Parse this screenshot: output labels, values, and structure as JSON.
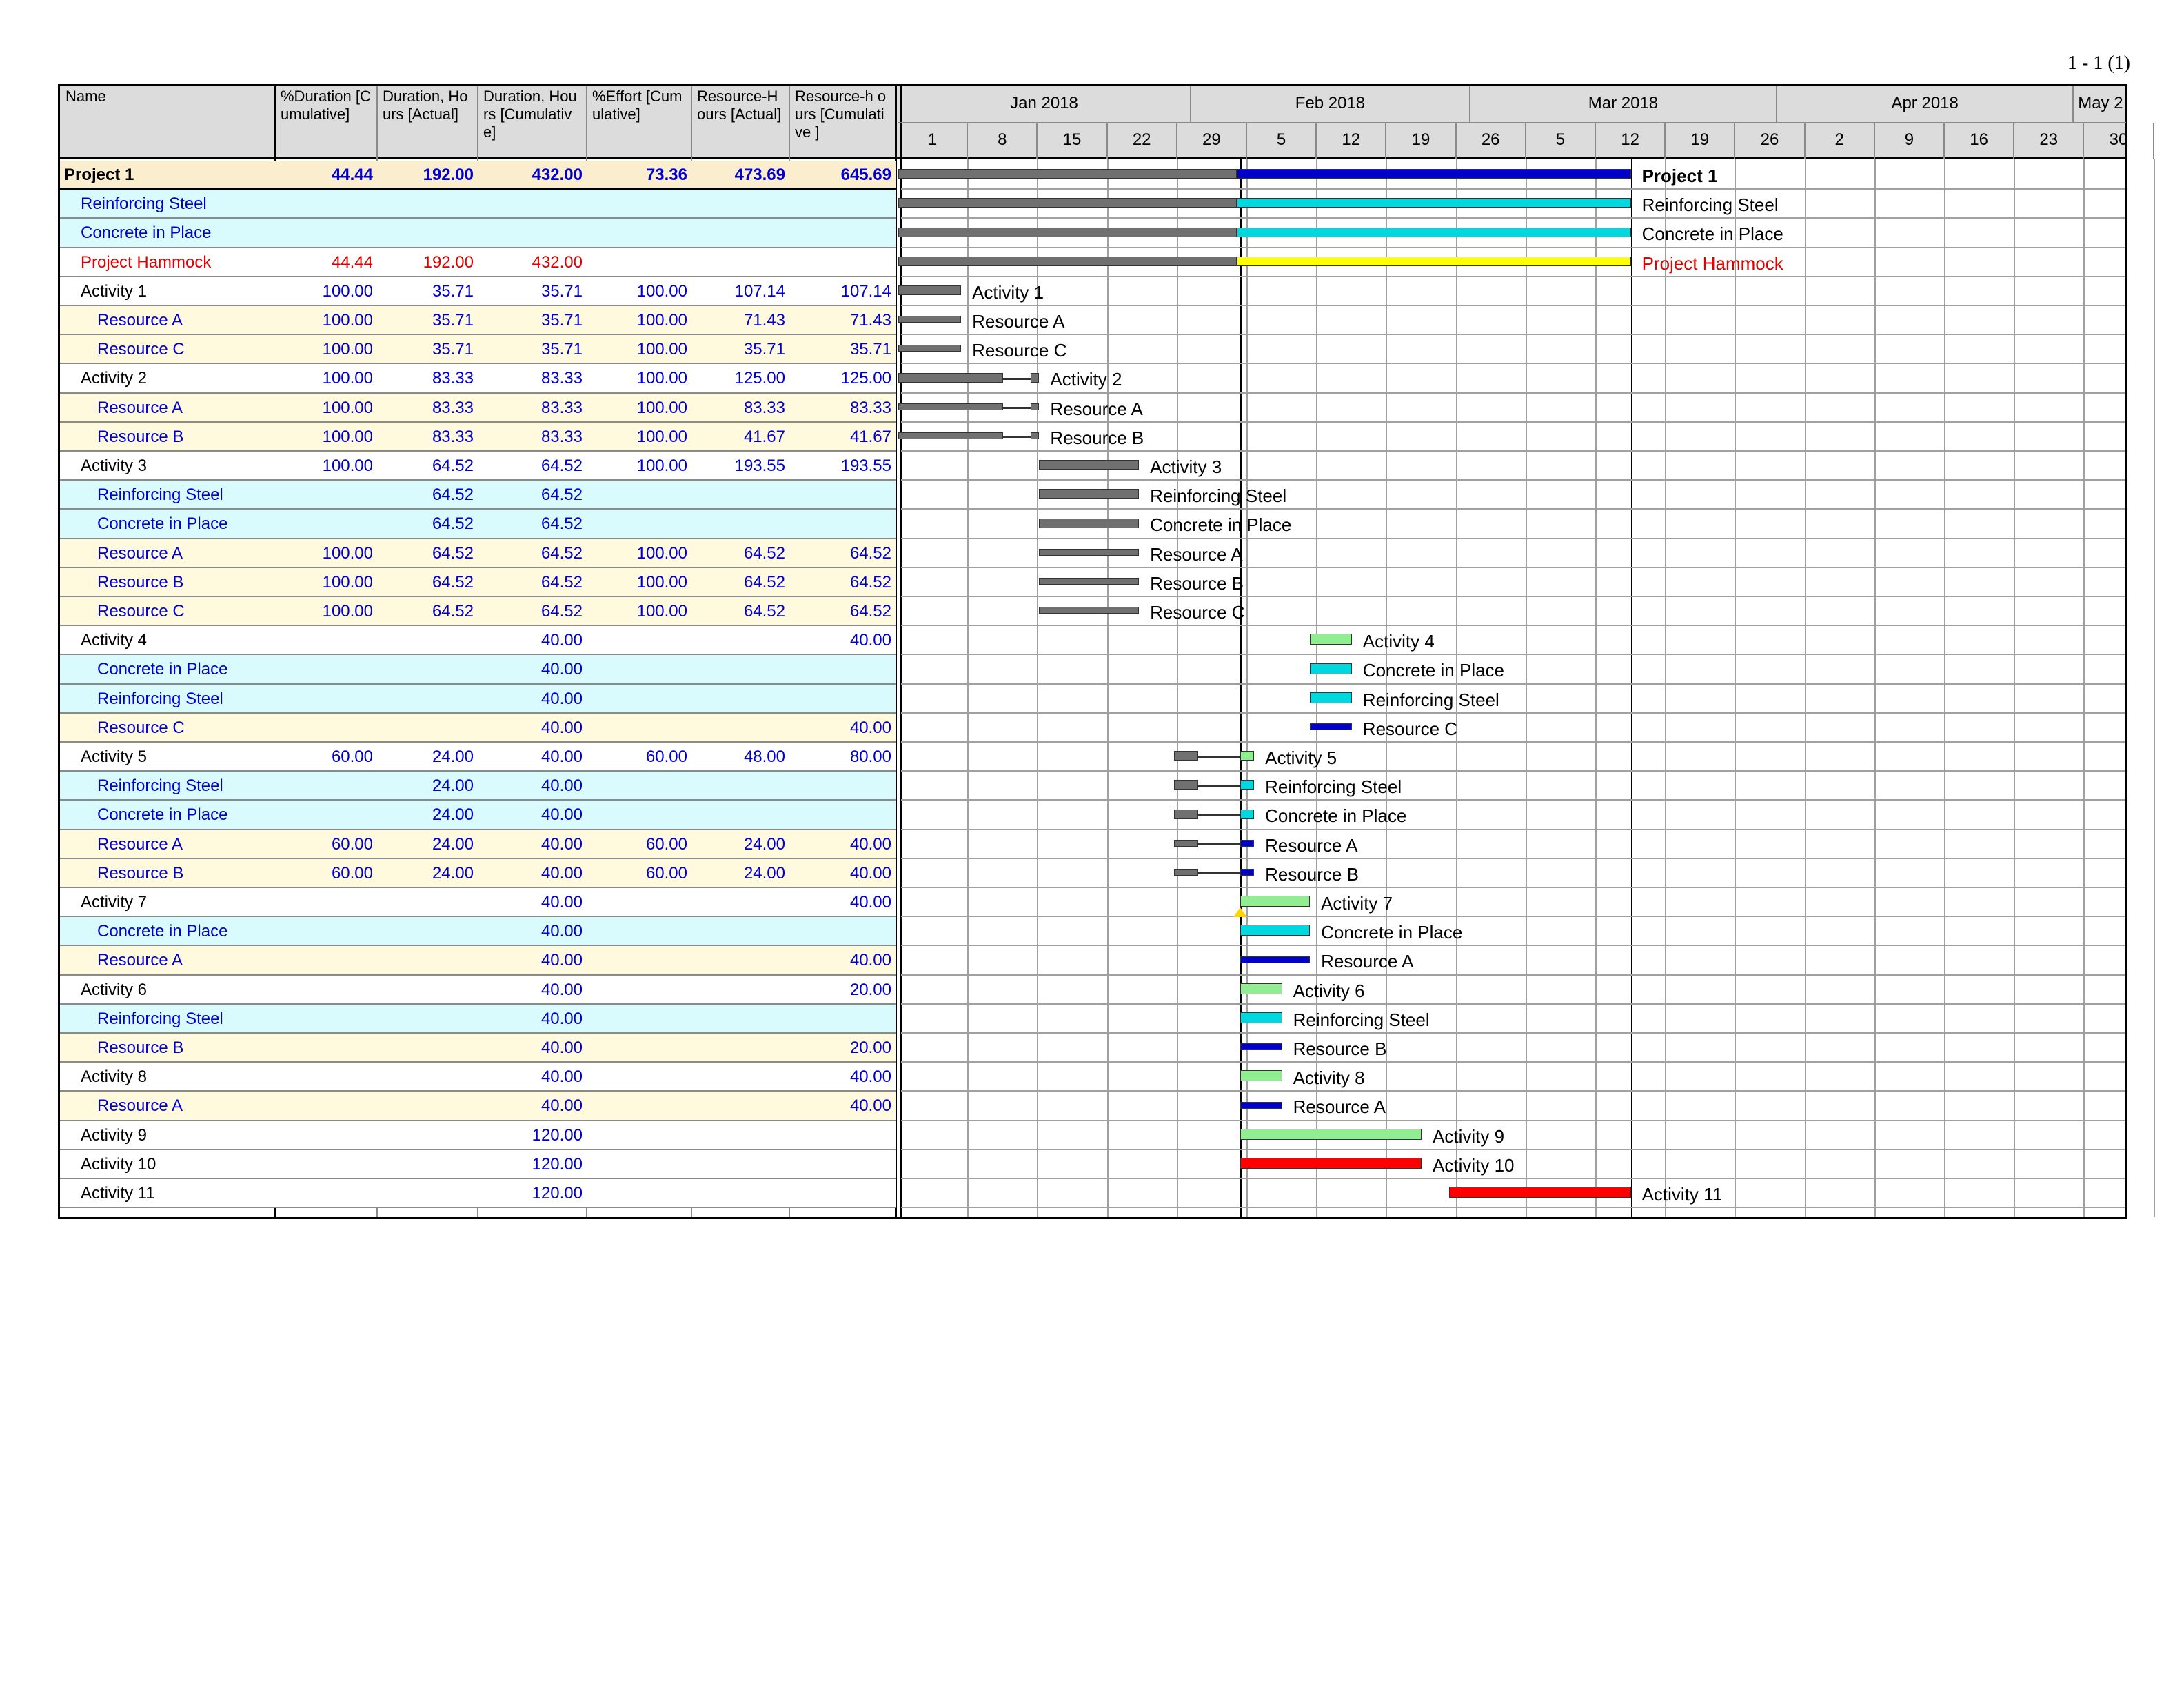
{
  "page_label": "1 - 1 (1)",
  "colors": {
    "header_bg": "#dcdcdc",
    "project_row": "#fbeecf",
    "resource_row": "#fff9de",
    "material_row": "#d9fbfd",
    "blue_text": "#0000cc",
    "red_text": "#e00000",
    "bar_gray": "#707070",
    "bar_blue": "#0000c8",
    "bar_cyan": "#00d8e0",
    "bar_yellow": "#ffff00",
    "bar_green": "#90ee90",
    "bar_red": "#ff0000"
  },
  "columns": [
    {
      "key": "name",
      "label": "Name"
    },
    {
      "key": "pct_dur",
      "label": "%Duration [Cumulative]"
    },
    {
      "key": "dur_act",
      "label": "Duration, Hours [Actual]"
    },
    {
      "key": "dur_cum",
      "label": "Duration, Hours [Cumulative]"
    },
    {
      "key": "pct_eff",
      "label": "%Effort [Cumulative]"
    },
    {
      "key": "res_act",
      "label": "Resource-H ours [Actual]"
    },
    {
      "key": "res_cum",
      "label": "Resource-h ours [Cumulative ]"
    }
  ],
  "timeline": {
    "months": [
      "Jan 2018",
      "Feb 2018",
      "Mar 2018",
      "Apr 2018",
      "May 2"
    ],
    "weeks": [
      "1",
      "8",
      "15",
      "22",
      "29",
      "5",
      "12",
      "19",
      "26",
      "5",
      "12",
      "19",
      "26",
      "2",
      "9",
      "16",
      "23",
      "30"
    ]
  },
  "rows": [
    {
      "name": "Project 1",
      "type": "project",
      "values": [
        "44.44",
        "192.00",
        "432.00",
        "73.36",
        "473.69",
        "645.69"
      ],
      "bar_label": "Project 1"
    },
    {
      "name": "Reinforcing Steel",
      "type": "material",
      "indent": 1,
      "values": [
        "",
        "",
        "",
        "",
        "",
        ""
      ],
      "bar_label": "Reinforcing Steel"
    },
    {
      "name": "Concrete in Place",
      "type": "material",
      "indent": 1,
      "values": [
        "",
        "",
        "",
        "",
        "",
        ""
      ],
      "bar_label": "Concrete in Place"
    },
    {
      "name": "Project Hammock",
      "type": "hammock",
      "indent": 1,
      "values": [
        "44.44",
        "192.00",
        "432.00",
        "",
        "",
        ""
      ],
      "bar_label": "Project Hammock"
    },
    {
      "name": "Activity 1",
      "type": "activity",
      "indent": 1,
      "values": [
        "100.00",
        "35.71",
        "35.71",
        "100.00",
        "107.14",
        "107.14"
      ],
      "bar_label": "Activity 1"
    },
    {
      "name": "Resource A",
      "type": "resource",
      "indent": 2,
      "values": [
        "100.00",
        "35.71",
        "35.71",
        "100.00",
        "71.43",
        "71.43"
      ],
      "bar_label": "Resource A"
    },
    {
      "name": "Resource C",
      "type": "resource",
      "indent": 2,
      "values": [
        "100.00",
        "35.71",
        "35.71",
        "100.00",
        "35.71",
        "35.71"
      ],
      "bar_label": "Resource C"
    },
    {
      "name": "Activity 2",
      "type": "activity",
      "indent": 1,
      "values": [
        "100.00",
        "83.33",
        "83.33",
        "100.00",
        "125.00",
        "125.00"
      ],
      "bar_label": "Activity 2"
    },
    {
      "name": "Resource A",
      "type": "resource",
      "indent": 2,
      "values": [
        "100.00",
        "83.33",
        "83.33",
        "100.00",
        "83.33",
        "83.33"
      ],
      "bar_label": "Resource A"
    },
    {
      "name": "Resource B",
      "type": "resource",
      "indent": 2,
      "values": [
        "100.00",
        "83.33",
        "83.33",
        "100.00",
        "41.67",
        "41.67"
      ],
      "bar_label": "Resource B"
    },
    {
      "name": "Activity 3",
      "type": "activity",
      "indent": 1,
      "values": [
        "100.00",
        "64.52",
        "64.52",
        "100.00",
        "193.55",
        "193.55"
      ],
      "bar_label": "Activity 3"
    },
    {
      "name": "Reinforcing Steel",
      "type": "material",
      "indent": 2,
      "values": [
        "",
        "64.52",
        "64.52",
        "",
        "",
        ""
      ],
      "bar_label": "Reinforcing Steel"
    },
    {
      "name": "Concrete in Place",
      "type": "material",
      "indent": 2,
      "values": [
        "",
        "64.52",
        "64.52",
        "",
        "",
        ""
      ],
      "bar_label": "Concrete in Place"
    },
    {
      "name": "Resource A",
      "type": "resource",
      "indent": 2,
      "values": [
        "100.00",
        "64.52",
        "64.52",
        "100.00",
        "64.52",
        "64.52"
      ],
      "bar_label": "Resource A"
    },
    {
      "name": "Resource B",
      "type": "resource",
      "indent": 2,
      "values": [
        "100.00",
        "64.52",
        "64.52",
        "100.00",
        "64.52",
        "64.52"
      ],
      "bar_label": "Resource B"
    },
    {
      "name": "Resource C",
      "type": "resource",
      "indent": 2,
      "values": [
        "100.00",
        "64.52",
        "64.52",
        "100.00",
        "64.52",
        "64.52"
      ],
      "bar_label": "Resource C"
    },
    {
      "name": "Activity 4",
      "type": "activity",
      "indent": 1,
      "values": [
        "",
        "",
        "40.00",
        "",
        "",
        "40.00"
      ],
      "bar_label": "Activity 4"
    },
    {
      "name": "Concrete in Place",
      "type": "material",
      "indent": 2,
      "values": [
        "",
        "",
        "40.00",
        "",
        "",
        ""
      ],
      "bar_label": "Concrete in Place"
    },
    {
      "name": "Reinforcing Steel",
      "type": "material",
      "indent": 2,
      "values": [
        "",
        "",
        "40.00",
        "",
        "",
        ""
      ],
      "bar_label": "Reinforcing Steel"
    },
    {
      "name": "Resource C",
      "type": "resource",
      "indent": 2,
      "values": [
        "",
        "",
        "40.00",
        "",
        "",
        "40.00"
      ],
      "bar_label": "Resource C"
    },
    {
      "name": "Activity 5",
      "type": "activity",
      "indent": 1,
      "values": [
        "60.00",
        "24.00",
        "40.00",
        "60.00",
        "48.00",
        "80.00"
      ],
      "bar_label": "Activity 5"
    },
    {
      "name": "Reinforcing Steel",
      "type": "material",
      "indent": 2,
      "values": [
        "",
        "24.00",
        "40.00",
        "",
        "",
        ""
      ],
      "bar_label": "Reinforcing Steel"
    },
    {
      "name": "Concrete in Place",
      "type": "material",
      "indent": 2,
      "values": [
        "",
        "24.00",
        "40.00",
        "",
        "",
        ""
      ],
      "bar_label": "Concrete in Place"
    },
    {
      "name": "Resource A",
      "type": "resource",
      "indent": 2,
      "values": [
        "60.00",
        "24.00",
        "40.00",
        "60.00",
        "24.00",
        "40.00"
      ],
      "bar_label": "Resource A"
    },
    {
      "name": "Resource B",
      "type": "resource",
      "indent": 2,
      "values": [
        "60.00",
        "24.00",
        "40.00",
        "60.00",
        "24.00",
        "40.00"
      ],
      "bar_label": "Resource B"
    },
    {
      "name": "Activity 7",
      "type": "activity",
      "indent": 1,
      "values": [
        "",
        "",
        "40.00",
        "",
        "",
        "40.00"
      ],
      "bar_label": "Activity 7"
    },
    {
      "name": "Concrete in Place",
      "type": "material",
      "indent": 2,
      "values": [
        "",
        "",
        "40.00",
        "",
        "",
        ""
      ],
      "bar_label": "Concrete in Place"
    },
    {
      "name": "Resource A",
      "type": "resource",
      "indent": 2,
      "values": [
        "",
        "",
        "40.00",
        "",
        "",
        "40.00"
      ],
      "bar_label": "Resource A"
    },
    {
      "name": "Activity 6",
      "type": "activity",
      "indent": 1,
      "values": [
        "",
        "",
        "40.00",
        "",
        "",
        "20.00"
      ],
      "bar_label": "Activity 6"
    },
    {
      "name": "Reinforcing Steel",
      "type": "material",
      "indent": 2,
      "values": [
        "",
        "",
        "40.00",
        "",
        "",
        ""
      ],
      "bar_label": "Reinforcing Steel"
    },
    {
      "name": "Resource B",
      "type": "resource",
      "indent": 2,
      "values": [
        "",
        "",
        "40.00",
        "",
        "",
        "20.00"
      ],
      "bar_label": "Resource B"
    },
    {
      "name": "Activity 8",
      "type": "activity",
      "indent": 1,
      "values": [
        "",
        "",
        "40.00",
        "",
        "",
        "40.00"
      ],
      "bar_label": "Activity 8"
    },
    {
      "name": "Resource A",
      "type": "resource",
      "indent": 2,
      "values": [
        "",
        "",
        "40.00",
        "",
        "",
        "40.00"
      ],
      "bar_label": "Resource A"
    },
    {
      "name": "Activity 9",
      "type": "activity",
      "indent": 1,
      "values": [
        "",
        "",
        "120.00",
        "",
        "",
        ""
      ],
      "bar_label": "Activity 9"
    },
    {
      "name": "Activity 10",
      "type": "activity",
      "indent": 1,
      "values": [
        "",
        "",
        "120.00",
        "",
        "",
        ""
      ],
      "bar_label": "Activity 10"
    },
    {
      "name": "Activity 11",
      "type": "activity",
      "indent": 1,
      "values": [
        "",
        "",
        "120.00",
        "",
        "",
        ""
      ],
      "bar_label": "Activity 11"
    }
  ]
}
